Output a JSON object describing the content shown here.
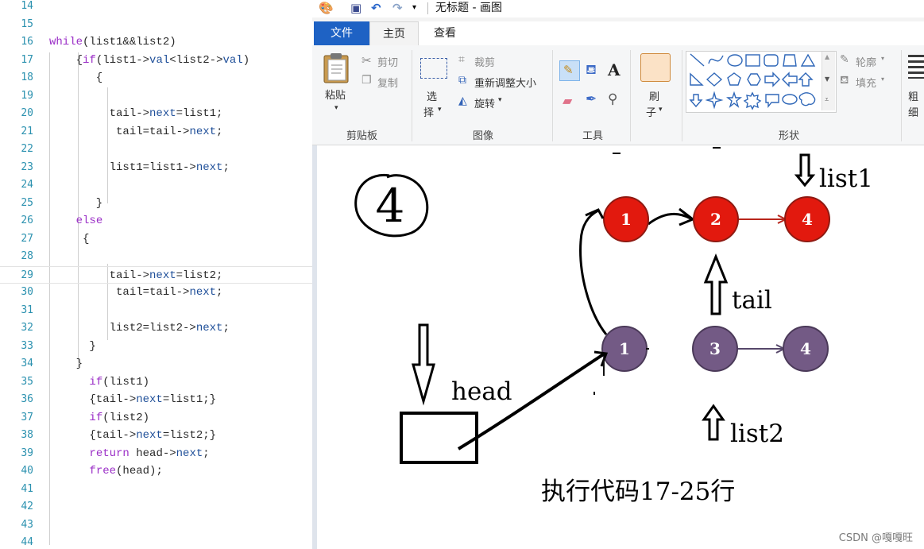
{
  "editor": {
    "lines": [
      {
        "n": "14",
        "code": ""
      },
      {
        "n": "15",
        "code": ""
      },
      {
        "n": "16",
        "code": "while(list1&&list2)"
      },
      {
        "n": "17",
        "code": "    {if(list1->val<list2->val)"
      },
      {
        "n": "18",
        "code": "       {"
      },
      {
        "n": "19",
        "code": ""
      },
      {
        "n": "20",
        "code": "         tail->next=list1;"
      },
      {
        "n": "21",
        "code": "          tail=tail->next;"
      },
      {
        "n": "22",
        "code": ""
      },
      {
        "n": "23",
        "code": "         list1=list1->next;"
      },
      {
        "n": "24",
        "code": ""
      },
      {
        "n": "25",
        "code": "       }"
      },
      {
        "n": "26",
        "code": "    else"
      },
      {
        "n": "27",
        "code": "     {"
      },
      {
        "n": "28",
        "code": ""
      },
      {
        "n": "29",
        "code": "         tail->next=list2;"
      },
      {
        "n": "30",
        "code": "          tail=tail->next;"
      },
      {
        "n": "31",
        "code": ""
      },
      {
        "n": "32",
        "code": "         list2=list2->next;"
      },
      {
        "n": "33",
        "code": "      }"
      },
      {
        "n": "34",
        "code": "    }"
      },
      {
        "n": "35",
        "code": "      if(list1)"
      },
      {
        "n": "36",
        "code": "      {tail->next=list1;}"
      },
      {
        "n": "37",
        "code": "      if(list2)"
      },
      {
        "n": "38",
        "code": "      {tail->next=list2;}"
      },
      {
        "n": "39",
        "code": "      return head->next;"
      },
      {
        "n": "40",
        "code": "      free(head);"
      },
      {
        "n": "41",
        "code": ""
      },
      {
        "n": "42",
        "code": ""
      },
      {
        "n": "43",
        "code": ""
      },
      {
        "n": "44",
        "code": ""
      }
    ],
    "current_line": "29"
  },
  "paint": {
    "title": "无标题 - 画图",
    "tabs": {
      "file": "文件",
      "home": "主页",
      "view": "查看"
    },
    "clipboard": {
      "paste": "粘贴",
      "cut": "剪切",
      "copy": "复制",
      "label": "剪贴板"
    },
    "image": {
      "select": "选",
      "select2": "择",
      "crop": "裁剪",
      "resize": "重新调整大小",
      "rotate": "旋转",
      "label": "图像"
    },
    "tools": {
      "label": "工具"
    },
    "brush": {
      "line1": "刷",
      "line2": "子"
    },
    "shapes": {
      "outline": "轮廓",
      "fill": "填充",
      "label": "形状"
    },
    "size": {
      "line1": "粗",
      "line2": "细"
    }
  },
  "drawing": {
    "step_number": "4",
    "caption": "执行代码17-25行",
    "labels": {
      "list1": "list1",
      "tail": "tail",
      "head": "head",
      "list2": "list2"
    },
    "red_nodes": [
      "1",
      "2",
      "4"
    ],
    "purple_nodes": [
      "1",
      "3",
      "4"
    ],
    "colors": {
      "red": "#e2190e",
      "purple": "#735a85"
    }
  },
  "watermark": "CSDN @嘎嘎旺"
}
